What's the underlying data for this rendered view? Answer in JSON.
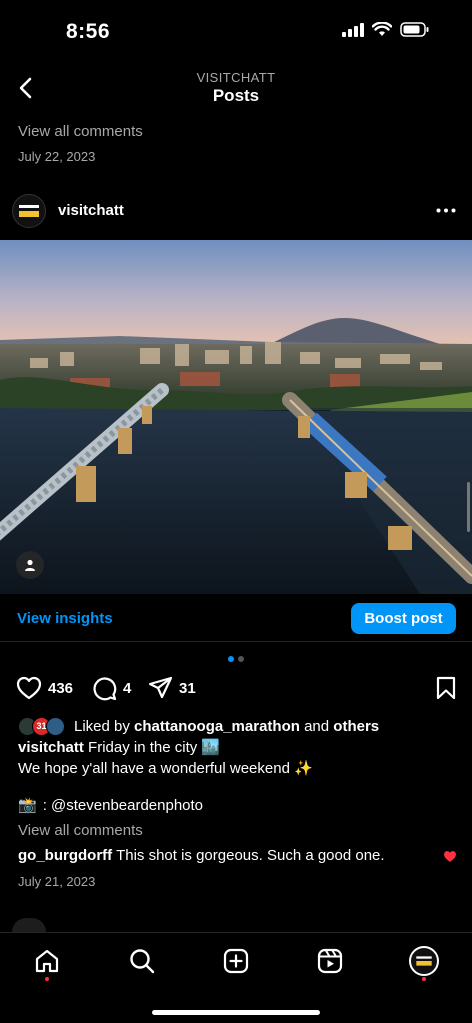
{
  "status_bar": {
    "time": "8:56"
  },
  "header": {
    "subtitle": "VISITCHATT",
    "title": "Posts"
  },
  "prev_post": {
    "view_all_comments": "View all comments",
    "date": "July 22, 2023"
  },
  "post": {
    "username": "visitchatt",
    "avatar_text": "CHATTA NOOGA",
    "insights_label": "View insights",
    "boost_label": "Boost post",
    "likes_count": "436",
    "comments_count": "4",
    "shares_count": "31",
    "liked_by_prefix": "Liked by",
    "liked_by_user": "chattanooga_marathon",
    "liked_by_and": "and",
    "liked_by_others": "others",
    "like_avatar_2_text": "31",
    "caption_user": "visitchatt",
    "caption_line1": "Friday in the city 🏙️",
    "caption_line2": "We hope y'all have a wonderful weekend ✨",
    "credit_emoji": "📸",
    "credit_text": ": @stevenbeardenphoto",
    "view_all_comments": "View all comments",
    "comment_user": "go_burgdorff",
    "comment_text": "This shot is gorgeous. Such a good one.",
    "date": "July 21, 2023"
  },
  "colors": {
    "accent_blue": "#0095f6",
    "secondary_text": "#a8a8a8",
    "notification_red": "#ff3040"
  },
  "icons": {
    "nav": [
      "home-icon",
      "search-icon",
      "create-icon",
      "reels-icon",
      "profile-avatar"
    ]
  }
}
